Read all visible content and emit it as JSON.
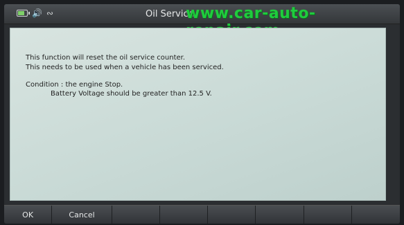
{
  "status": {
    "battery_icon": "battery-icon",
    "sound_icon": "speaker-icon",
    "wifi_icon": "wifi-icon"
  },
  "title": "Oil Service",
  "watermark": "www.car-auto-repair.com",
  "message": {
    "line1": "This function will reset the oil service counter.",
    "line2": "This needs to be used when a vehicle has been serviced.",
    "line3": "Condition : the engine Stop.",
    "line4": "Battery Voltage should be greater than 12.5 V."
  },
  "footer": {
    "ok_label": "OK",
    "cancel_label": "Cancel"
  },
  "colors": {
    "panel_bg": "#c9dad6",
    "watermark": "#1fcc3d",
    "chrome": "#34373a"
  }
}
